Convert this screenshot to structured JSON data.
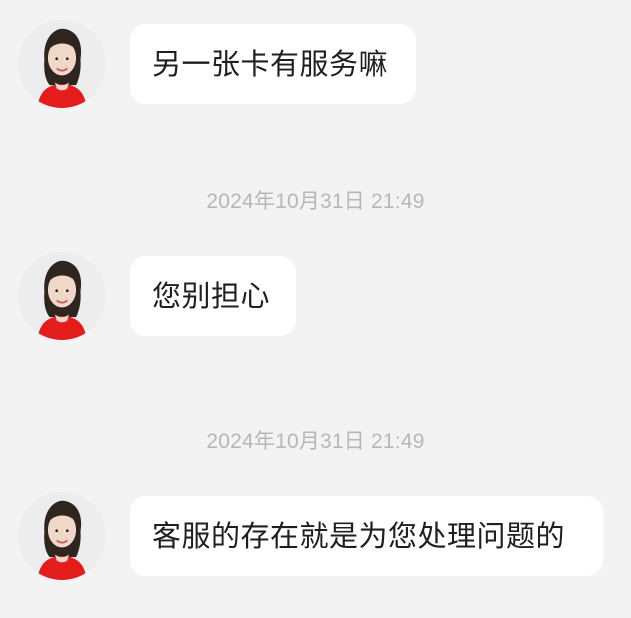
{
  "chat": {
    "messages": [
      {
        "text": "另一张卡有服务嘛"
      },
      {
        "timestamp": "2024年10月31日 21:49"
      },
      {
        "text": "您别担心"
      },
      {
        "timestamp": "2024年10月31日 21:49"
      },
      {
        "text": "客服的存在就是为您处理问题的"
      }
    ],
    "avatar": {
      "icon": "avatar-photo-icon"
    }
  },
  "colors": {
    "background": "#f3f3f3",
    "bubble": "#ffffff",
    "timestamp": "#b7b7b7",
    "text": "#1f1f1f",
    "shirt": "#e31c1c"
  }
}
